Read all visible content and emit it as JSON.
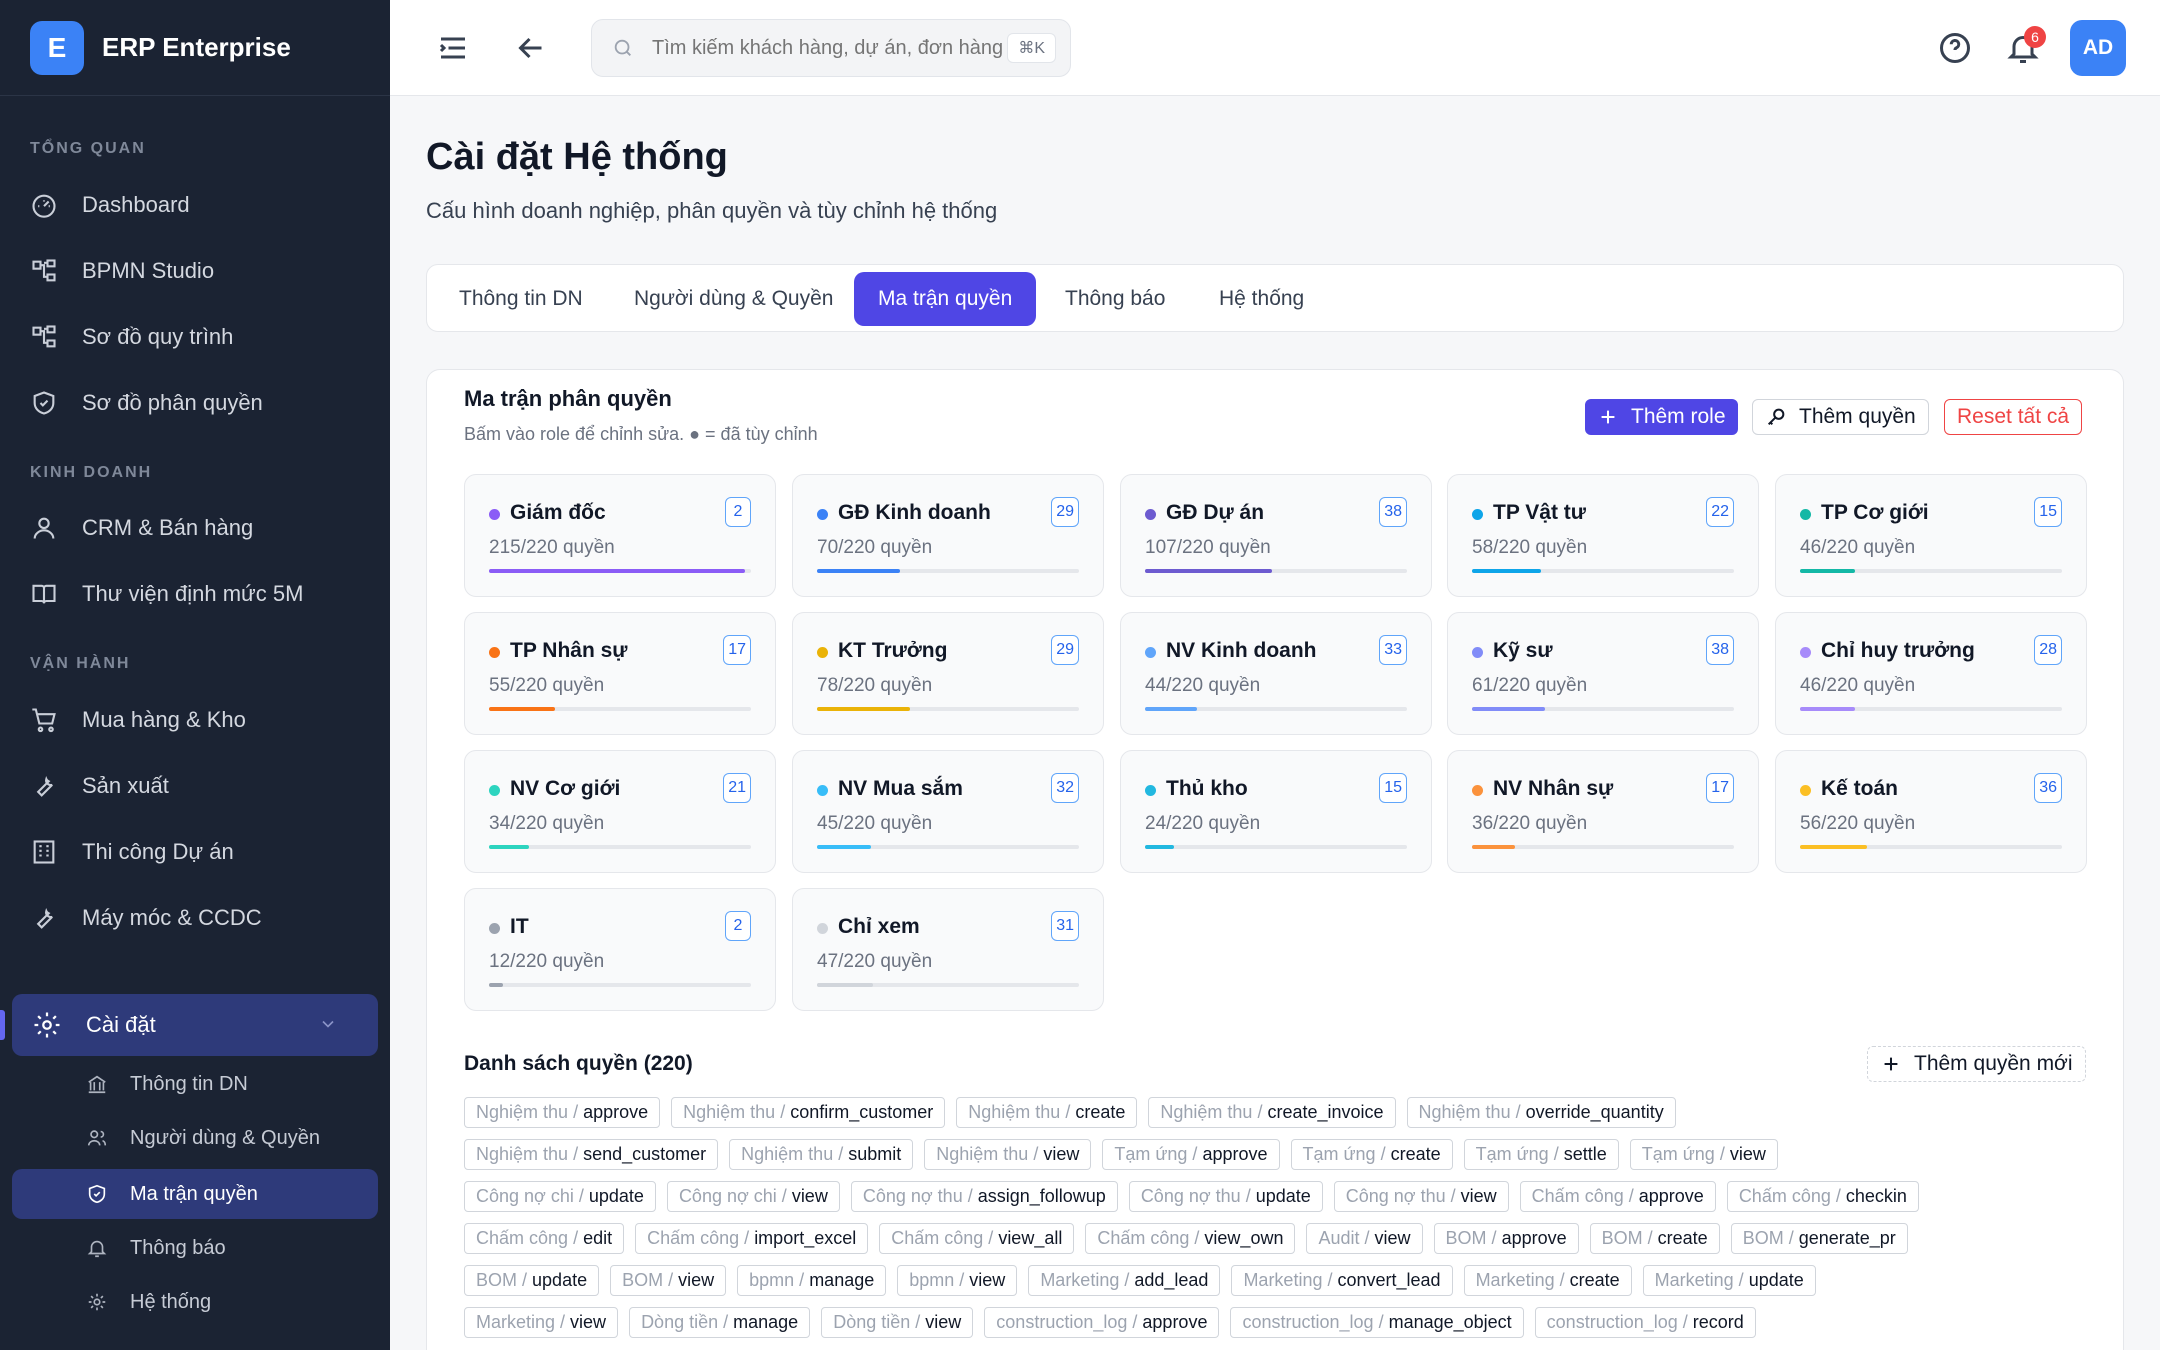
{
  "brand": {
    "logo": "E",
    "name": "ERP Enterprise"
  },
  "sidebar": {
    "sections": [
      {
        "label": "TỔNG QUAN",
        "items": [
          {
            "label": "Dashboard",
            "icon": "gauge-icon"
          },
          {
            "label": "BPMN Studio",
            "icon": "flow-icon"
          },
          {
            "label": "Sơ đồ quy trình",
            "icon": "flow-icon"
          },
          {
            "label": "Sơ đồ phân quyền",
            "icon": "shield-icon"
          }
        ]
      },
      {
        "label": "KINH DOANH",
        "items": [
          {
            "label": "CRM & Bán hàng",
            "icon": "user-icon"
          },
          {
            "label": "Thư viện định mức 5M",
            "icon": "book-icon"
          }
        ]
      },
      {
        "label": "VẬN HÀNH",
        "items": [
          {
            "label": "Mua hàng & Kho",
            "icon": "cart-icon"
          },
          {
            "label": "Sản xuất",
            "icon": "wrench-icon"
          },
          {
            "label": "Thi công Dự án",
            "icon": "building-icon"
          },
          {
            "label": "Máy móc & CCDC",
            "icon": "wrench-icon"
          }
        ]
      }
    ],
    "settings": {
      "label": "Cài đặt",
      "sub": [
        {
          "label": "Thông tin DN"
        },
        {
          "label": "Người dùng & Quyền"
        },
        {
          "label": "Ma trận quyền"
        },
        {
          "label": "Thông báo"
        },
        {
          "label": "Hệ thống"
        }
      ]
    }
  },
  "header": {
    "search_placeholder": "Tìm kiếm khách hàng, dự án, đơn hàng...",
    "shortcut": "⌘K",
    "notification_count": "6",
    "avatar": "AD"
  },
  "page": {
    "title": "Cài đặt Hệ thống",
    "subtitle": "Cấu hình doanh nghiệp, phân quyền và tùy chỉnh hệ thống"
  },
  "tabs": [
    {
      "label": "Thông tin DN"
    },
    {
      "label": "Người dùng & Quyền"
    },
    {
      "label": "Ma trận quyền",
      "active": true
    },
    {
      "label": "Thông báo"
    },
    {
      "label": "Hệ thống"
    }
  ],
  "matrix": {
    "title": "Ma trận phân quyền",
    "subtitle": "Bấm vào role để chỉnh sửa. ● = đã tùy chỉnh",
    "buttons": {
      "add_role": "Thêm role",
      "add_perm": "Thêm quyền",
      "reset": "Reset tất cả"
    },
    "roles": [
      {
        "name": "Giám đốc",
        "count": "2",
        "perm": "215/220 quyền",
        "granted": 215,
        "color": "#8b5cf6"
      },
      {
        "name": "GĐ Kinh doanh",
        "count": "29",
        "perm": "70/220 quyền",
        "granted": 70,
        "color": "#3b82f6"
      },
      {
        "name": "GĐ Dự án",
        "count": "38",
        "perm": "107/220 quyền",
        "granted": 107,
        "color": "#6d5bd0"
      },
      {
        "name": "TP Vật tư",
        "count": "22",
        "perm": "58/220 quyền",
        "granted": 58,
        "color": "#0ea5e9"
      },
      {
        "name": "TP Cơ giới",
        "count": "15",
        "perm": "46/220 quyền",
        "granted": 46,
        "color": "#14b8a6"
      },
      {
        "name": "TP Nhân sự",
        "count": "17",
        "perm": "55/220 quyền",
        "granted": 55,
        "color": "#f97316"
      },
      {
        "name": "KT Trưởng",
        "count": "29",
        "perm": "78/220 quyền",
        "granted": 78,
        "color": "#eab308"
      },
      {
        "name": "NV Kinh doanh",
        "count": "33",
        "perm": "44/220 quyền",
        "granted": 44,
        "color": "#60a5fa"
      },
      {
        "name": "Kỹ sư",
        "count": "38",
        "perm": "61/220 quyền",
        "granted": 61,
        "color": "#818cf8"
      },
      {
        "name": "Chỉ huy trưởng",
        "count": "28",
        "perm": "46/220 quyền",
        "granted": 46,
        "color": "#a78bfa"
      },
      {
        "name": "NV Cơ giới",
        "count": "21",
        "perm": "34/220 quyền",
        "granted": 34,
        "color": "#2dd4bf"
      },
      {
        "name": "NV Mua sắm",
        "count": "32",
        "perm": "45/220 quyền",
        "granted": 45,
        "color": "#38bdf8"
      },
      {
        "name": "Thủ kho",
        "count": "15",
        "perm": "24/220 quyền",
        "granted": 24,
        "color": "#22b8e0"
      },
      {
        "name": "NV Nhân sự",
        "count": "17",
        "perm": "36/220 quyền",
        "granted": 36,
        "color": "#fb923c"
      },
      {
        "name": "Kế toán",
        "count": "36",
        "perm": "56/220 quyền",
        "granted": 56,
        "color": "#fbbf24"
      },
      {
        "name": "IT",
        "count": "2",
        "perm": "12/220 quyền",
        "granted": 12,
        "color": "#9ca3af"
      },
      {
        "name": "Chỉ xem",
        "count": "31",
        "perm": "47/220 quyền",
        "granted": 47,
        "color": "#d1d5db"
      }
    ],
    "list_title": "Danh sách quyền (220)",
    "add_new": "Thêm quyền mới",
    "permissions": [
      [
        [
          "Nghiệm thu",
          "approve"
        ],
        [
          "Nghiệm thu",
          "confirm_customer"
        ],
        [
          "Nghiệm thu",
          "create"
        ],
        [
          "Nghiệm thu",
          "create_invoice"
        ],
        [
          "Nghiệm thu",
          "override_quantity"
        ]
      ],
      [
        [
          "Nghiệm thu",
          "send_customer"
        ],
        [
          "Nghiệm thu",
          "submit"
        ],
        [
          "Nghiệm thu",
          "view"
        ],
        [
          "Tạm ứng",
          "approve"
        ],
        [
          "Tạm ứng",
          "create"
        ],
        [
          "Tạm ứng",
          "settle"
        ],
        [
          "Tạm ứng",
          "view"
        ]
      ],
      [
        [
          "Công nợ chi",
          "update"
        ],
        [
          "Công nợ chi",
          "view"
        ],
        [
          "Công nợ thu",
          "assign_followup"
        ],
        [
          "Công nợ thu",
          "update"
        ],
        [
          "Công nợ thu",
          "view"
        ],
        [
          "Chấm công",
          "approve"
        ],
        [
          "Chấm công",
          "checkin"
        ]
      ],
      [
        [
          "Chấm công",
          "edit"
        ],
        [
          "Chấm công",
          "import_excel"
        ],
        [
          "Chấm công",
          "view_all"
        ],
        [
          "Chấm công",
          "view_own"
        ],
        [
          "Audit",
          "view"
        ],
        [
          "BOM",
          "approve"
        ],
        [
          "BOM",
          "create"
        ],
        [
          "BOM",
          "generate_pr"
        ]
      ],
      [
        [
          "BOM",
          "update"
        ],
        [
          "BOM",
          "view"
        ],
        [
          "bpmn",
          "manage"
        ],
        [
          "bpmn",
          "view"
        ],
        [
          "Marketing",
          "add_lead"
        ],
        [
          "Marketing",
          "convert_lead"
        ],
        [
          "Marketing",
          "create"
        ],
        [
          "Marketing",
          "update"
        ]
      ],
      [
        [
          "Marketing",
          "view"
        ],
        [
          "Dòng tiền",
          "manage"
        ],
        [
          "Dòng tiền",
          "view"
        ],
        [
          "construction_log",
          "approve"
        ],
        [
          "construction_log",
          "manage_object"
        ],
        [
          "construction_log",
          "record"
        ]
      ]
    ]
  }
}
